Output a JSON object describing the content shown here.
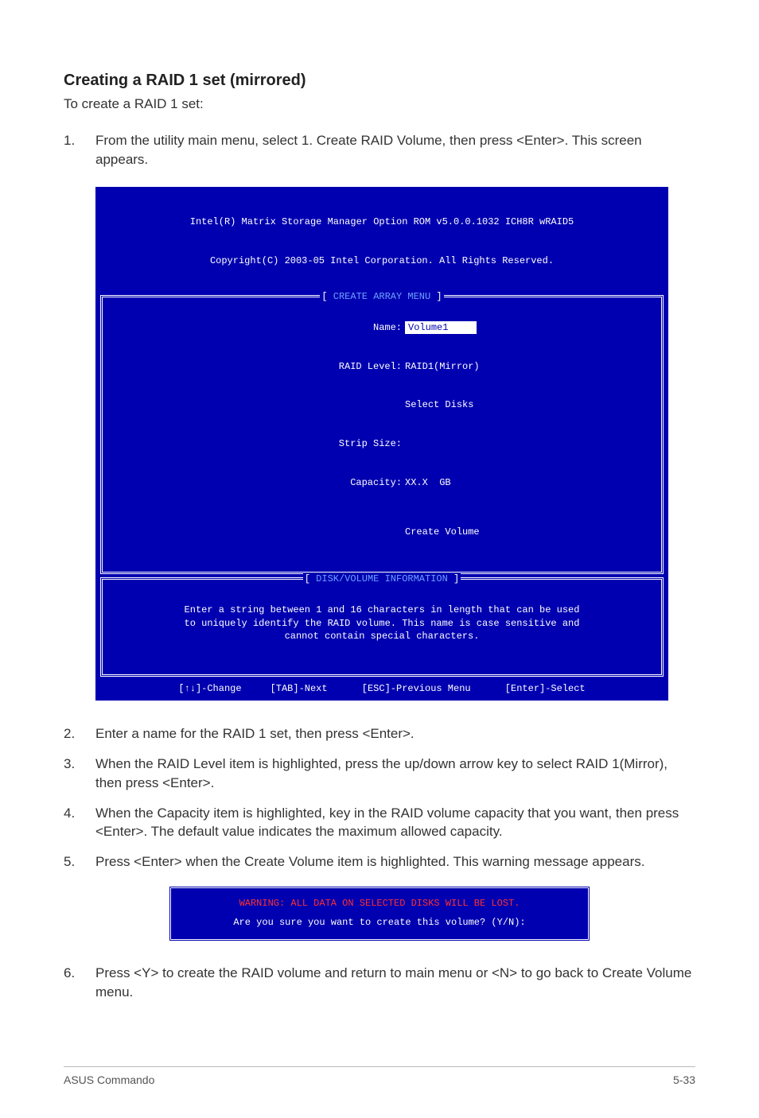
{
  "section": {
    "heading": "Creating a RAID 1 set (mirrored)",
    "intro": "To create a RAID 1 set:"
  },
  "steps_block1": {
    "s1": "From the utility main menu, select 1. Create RAID Volume, then press <Enter>. This screen appears."
  },
  "console": {
    "title_line1": "Intel(R) Matrix Storage Manager Option ROM v5.0.0.1032 ICH8R wRAID5",
    "title_line2": "Copyright(C) 2003-05 Intel Corporation. All Rights Reserved.",
    "panel1_title": "CREATE ARRAY MENU",
    "fields": {
      "name_label": "Name:",
      "name_value": "Volume1",
      "raid_level_label": "RAID Level:",
      "raid_level_value": "RAID1(Mirror)",
      "select_disks_value": "Select Disks",
      "strip_size_label": "Strip Size:",
      "capacity_label": "Capacity:",
      "capacity_value": "XX.X  GB",
      "create_volume": "Create Volume"
    },
    "panel2_title": "DISK/VOLUME INFORMATION",
    "help_text": "Enter a string between 1 and 16 characters in length that can be used\nto uniquely identify the RAID volume. This name is case sensitive and\ncannot contain special characters.",
    "footer": "[↑↓]-Change     [TAB]-Next      [ESC]-Previous Menu      [Enter]-Select"
  },
  "steps_block2": {
    "s2": "Enter a name for the RAID 1 set, then press <Enter>.",
    "s3": "When the RAID Level item is highlighted, press the up/down arrow key to select RAID 1(Mirror), then press <Enter>.",
    "s4": "When the Capacity item is highlighted, key in the RAID volume capacity that you want, then press <Enter>. The default value indicates the maximum allowed capacity.",
    "s5": "Press <Enter> when the Create Volume item is highlighted. This warning message appears."
  },
  "warning_dialog": {
    "head": "WARNING: ALL DATA ON SELECTED DISKS WILL BE LOST.",
    "body": "Are you sure you want to create this volume? (Y/N):"
  },
  "steps_block3": {
    "s6": "Press <Y> to create the RAID volume and return to main menu or <N> to go back to Create Volume menu."
  },
  "footer": {
    "left": "ASUS Commando",
    "right": "5-33"
  }
}
